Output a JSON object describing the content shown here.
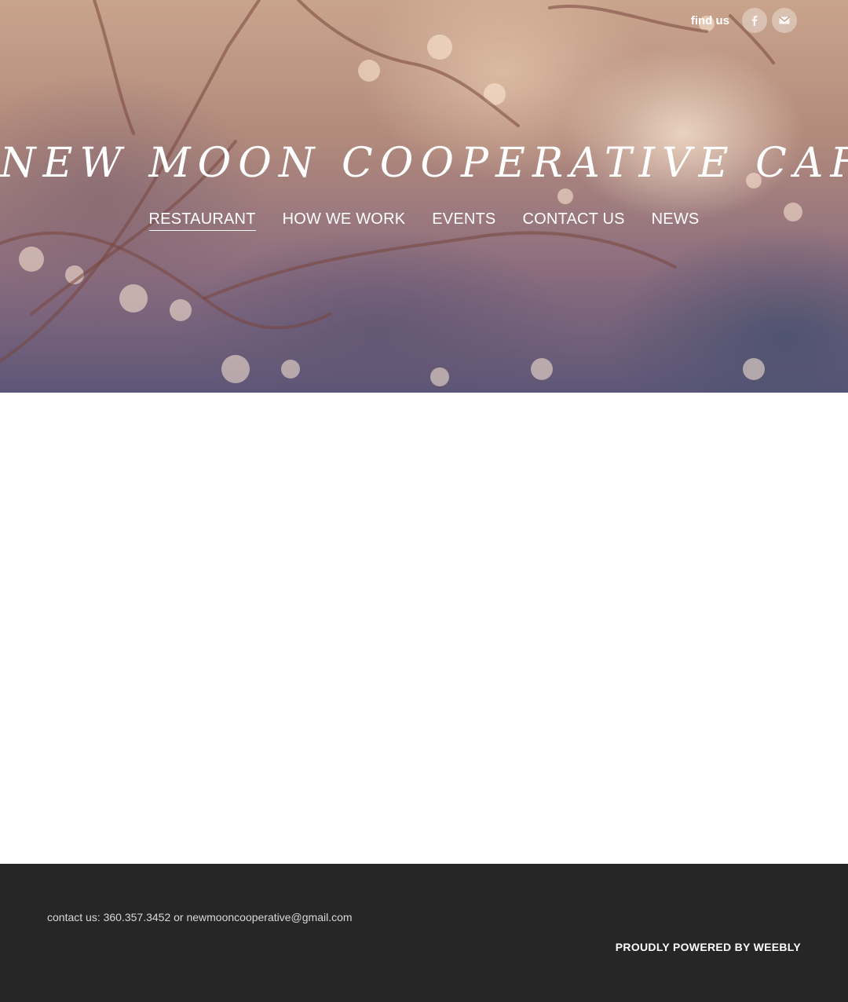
{
  "header": {
    "find_us_label": "find us",
    "social": [
      {
        "icon": "facebook-icon",
        "glyph": "f"
      },
      {
        "icon": "mail-icon",
        "glyph": "✉"
      }
    ],
    "site_title": "NEW MOON COOPERATIVE CAFE"
  },
  "nav": {
    "items": [
      {
        "label": "RESTAURANT",
        "active": true
      },
      {
        "label": "HOW WE WORK",
        "active": false
      },
      {
        "label": "EVENTS",
        "active": false
      },
      {
        "label": "CONTACT US",
        "active": false
      },
      {
        "label": "NEWS",
        "active": false
      }
    ]
  },
  "footer": {
    "contact_text": "contact us: 360.357.3452 or newmooncooperative@gmail.com",
    "powered_label": "PROUDLY POWERED BY WEEBLY"
  },
  "colors": {
    "footer_bg": "#262626",
    "text_light": "#ffffff"
  }
}
